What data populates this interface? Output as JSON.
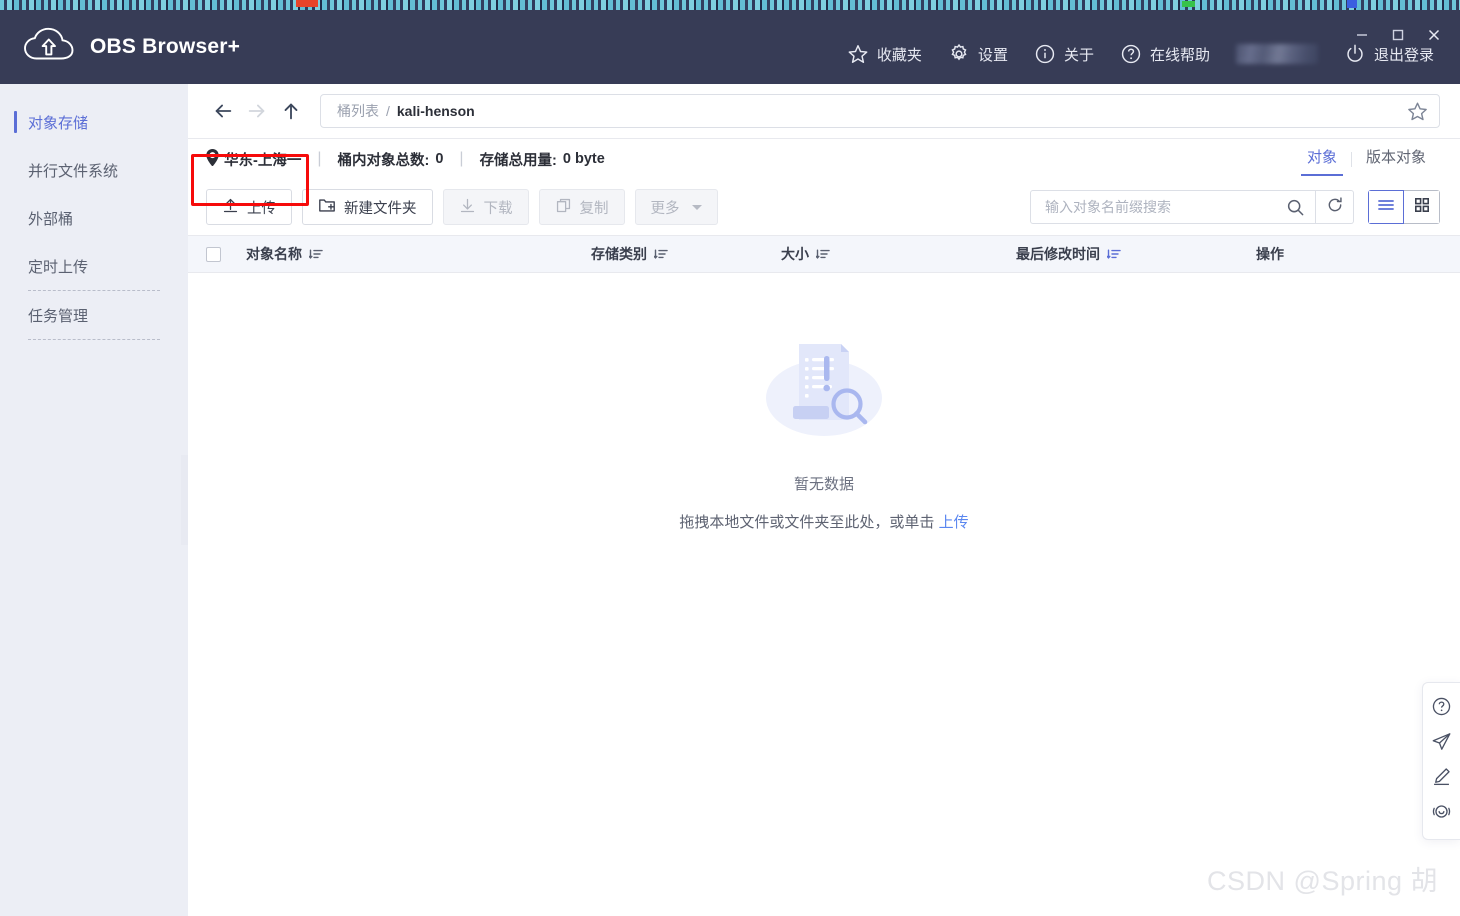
{
  "app": {
    "title": "OBS Browser+",
    "logo_icon": "cloud-upload-icon"
  },
  "window_controls": {
    "minimize": "−",
    "maximize": "□",
    "close": "✕"
  },
  "header_menu": [
    {
      "label": "收藏夹",
      "icon": "star-icon"
    },
    {
      "label": "设置",
      "icon": "gear-icon"
    },
    {
      "label": "关于",
      "icon": "info-icon"
    },
    {
      "label": "在线帮助",
      "icon": "question-circle-icon"
    },
    {
      "label": "退出登录",
      "icon": "power-icon"
    }
  ],
  "sidebar": {
    "items": [
      {
        "label": "对象存储",
        "active": true
      },
      {
        "label": "并行文件系统",
        "active": false
      },
      {
        "label": "外部桶",
        "active": false
      },
      {
        "label": "定时上传",
        "active": false
      },
      {
        "label": "任务管理",
        "active": false
      }
    ]
  },
  "breadcrumb": {
    "back_icon": "arrow-left-icon",
    "forward_icon": "arrow-right-icon",
    "up_icon": "arrow-up-icon",
    "root": "桶列表",
    "separator": "/",
    "current": "kali-henson",
    "favorite_icon": "star-outline-icon"
  },
  "info_bar": {
    "region_icon": "location-pin-icon",
    "region": "华东-上海一",
    "divider": "|",
    "object_count_label": "桶内对象总数:",
    "object_count": "0",
    "storage_label": "存储总用量:",
    "storage_value": "0 byte"
  },
  "tabs": [
    {
      "label": "对象",
      "active": true
    },
    {
      "label": "版本对象",
      "active": false
    }
  ],
  "toolbar": {
    "buttons": [
      {
        "label": "上传",
        "icon": "upload-icon",
        "disabled": false,
        "highlighted": true
      },
      {
        "label": "新建文件夹",
        "icon": "new-folder-icon",
        "disabled": false,
        "highlighted": false
      },
      {
        "label": "下载",
        "icon": "download-icon",
        "disabled": true,
        "highlighted": false
      },
      {
        "label": "复制",
        "icon": "copy-icon",
        "disabled": true,
        "highlighted": false
      },
      {
        "label": "更多",
        "icon": "chevron-down-icon",
        "disabled": true,
        "highlighted": false
      }
    ]
  },
  "search": {
    "placeholder": "输入对象名前缀搜索",
    "value": "",
    "search_icon": "search-icon",
    "refresh_icon": "refresh-icon"
  },
  "view_toggle": {
    "list_icon": "list-view-icon",
    "grid_icon": "grid-view-icon",
    "active": "list"
  },
  "table": {
    "columns": [
      {
        "label": "对象名称",
        "sortable": true,
        "sort_active": false
      },
      {
        "label": "存储类别",
        "sortable": true,
        "sort_active": false
      },
      {
        "label": "大小",
        "sortable": true,
        "sort_active": false
      },
      {
        "label": "最后修改时间",
        "sortable": true,
        "sort_active": true
      },
      {
        "label": "操作",
        "sortable": false,
        "sort_active": false
      }
    ],
    "rows": []
  },
  "empty_state": {
    "illustration": "empty-document-search-icon",
    "title": "暂无数据",
    "hint_prefix": "拖拽本地文件或文件夹至此处，或单击 ",
    "hint_link": "上传"
  },
  "float_toolbar": [
    {
      "icon": "question-circle-icon",
      "name": "help"
    },
    {
      "icon": "paper-plane-icon",
      "name": "feedback"
    },
    {
      "icon": "pencil-icon",
      "name": "write"
    },
    {
      "icon": "smiley-chat-icon",
      "name": "satisfaction"
    }
  ],
  "watermark": "CSDN @Spring  胡",
  "colors": {
    "titlebar_bg": "#373c56",
    "sidebar_bg": "#eceef5",
    "accent": "#5b6ed6",
    "highlight_box": "#f60b0b",
    "table_header_bg": "#f4f6fb",
    "link": "#5b87f0"
  }
}
